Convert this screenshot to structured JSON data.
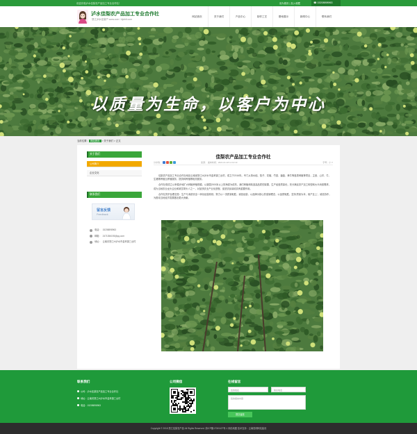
{
  "topbar": {
    "welcome": "欢迎光临泸水佳梨农产品加工专业合作社！",
    "links": "设为首页 | 加入收藏",
    "phone": "15208898963"
  },
  "header": {
    "brand": "泸水佳梨农产品加工专业合作社",
    "subtitle": "怒江泸水佳梨产 www.com  /  hjlzhlt.com",
    "nav": [
      "网站首页",
      "关于我们",
      "产品中心",
      "制作工艺",
      "基地展示",
      "新闻中心",
      "联系我们"
    ]
  },
  "banner": {
    "slogan": "以质量为生命，以客户为中心"
  },
  "breadcrumb": {
    "label": "当前位置：",
    "home": "网站首页",
    "sep": " > ",
    "current": "关于我们 > 正文"
  },
  "sidebar": {
    "about_title": "关于我们",
    "about_items": [
      "公司简介",
      "企业文化"
    ],
    "contact_title": "联系我们",
    "feedback_title": "留言反馈",
    "feedback_sub": "Feedback",
    "contacts": [
      {
        "label": "电话：",
        "value": "15208898963"
      },
      {
        "label": "邮箱：",
        "value": "2471356193@qq.com"
      },
      {
        "label": "地址：",
        "value": "云南省怒江州泸水市金禾镇三台村"
      }
    ]
  },
  "article": {
    "title": "佳梨农产品加工专业合作社",
    "share_label": "分享到：",
    "info": "来源：        发布时间：2021-01-18 11:10:19",
    "font_size": "字号：小 T",
    "paragraphs": [
      "佳梨农产品加工专业合作社地处云南省怒江州泸水市金禾镇三台村，成立于2016年。专门从事水稻、茄子、花椒、竹鼠、菌菇、黄牛等各类种植等项目，主营、山羊、牛、生猪等养殖业养殖服务，提供种养殖等相关服务。",
      "合作社现成立以来稳步地扩大种植养殖规模，以梨园2000米以上的海拔为依托，我们种植和精选高品质的梨果，生产经营质量优，充分满足农户加工转型和大众消费需求，成为当地农业龙头企业和致富带头人之一，对加快农业产业化进程、促进农民增收具有重要作用。",
      "合作社的宗旨理念是：生产与消费安全一体化经营原则，努力以一流质量取胜，诚信经营，以品牌为核心的营销理念，以品质取胜，坚持'质量为本，用户至上'，诚信协作，为推动当地经济发展做出更大贡献。"
    ]
  },
  "footer": {
    "contact_title": "联系我们",
    "contact_lines": [
      "公司：泸水佳梨农产品加工专业合作社",
      "地址：云南省怒江州泸水市金禾镇三台村",
      "电话：15208898963"
    ],
    "wechat_title": "公司微信",
    "message_title": "在线留言",
    "name_placeholder": "您的姓名",
    "phone_placeholder": "联系电话",
    "content_placeholder": "您的留言内容",
    "submit": "提交留言"
  },
  "copyright": "Copyright © 2018 怒江佳梨农产品 All Rights Reserved.  滇ICP备17000427号-1  网站地图  技术支持：云南昆明网站建设"
}
